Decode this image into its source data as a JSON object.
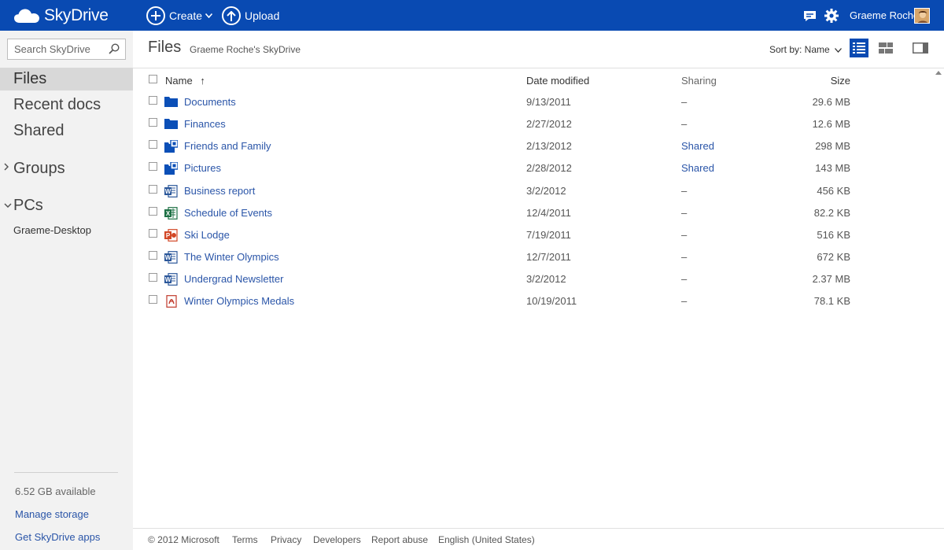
{
  "topbar": {
    "brand": "SkyDrive",
    "create_label": "Create",
    "upload_label": "Upload",
    "user_name": "Graeme Roche",
    "brand_color": "#094ab2"
  },
  "search": {
    "placeholder": "Search SkyDrive"
  },
  "nav": {
    "files": "Files",
    "recent": "Recent docs",
    "shared": "Shared",
    "groups": "Groups",
    "pcs": "PCs",
    "pc_name": "Graeme-Desktop",
    "storage": "6.52 GB available",
    "manage_storage": "Manage storage",
    "get_apps": "Get SkyDrive apps"
  },
  "header": {
    "title": "Files",
    "crumb": "Graeme Roche's SkyDrive",
    "sort_label": "Sort by: Name"
  },
  "columns": {
    "name": "Name",
    "sort_arrow": "↑",
    "date": "Date modified",
    "sharing": "Sharing",
    "size": "Size"
  },
  "files": [
    {
      "icon": "folder-icon",
      "name": "Documents",
      "date": "9/13/2011",
      "sharing": "–",
      "size": "29.6 MB"
    },
    {
      "icon": "folder-icon",
      "name": "Finances",
      "date": "2/27/2012",
      "sharing": "–",
      "size": "12.6 MB"
    },
    {
      "icon": "shared-folder-icon",
      "name": "Friends and Family",
      "date": "2/13/2012",
      "sharing": "Shared",
      "size": "298 MB"
    },
    {
      "icon": "shared-folder-icon",
      "name": "Pictures",
      "date": "2/28/2012",
      "sharing": "Shared",
      "size": "143 MB"
    },
    {
      "icon": "word-doc-icon",
      "name": "Business report",
      "date": "3/2/2012",
      "sharing": "–",
      "size": "456 KB"
    },
    {
      "icon": "excel-doc-icon",
      "name": "Schedule of Events",
      "date": "12/4/2011",
      "sharing": "–",
      "size": "82.2 KB"
    },
    {
      "icon": "powerpoint-doc-icon",
      "name": "Ski Lodge",
      "date": "7/19/2011",
      "sharing": "–",
      "size": "516 KB"
    },
    {
      "icon": "word-doc-icon",
      "name": "The Winter Olympics",
      "date": "12/7/2011",
      "sharing": "–",
      "size": "672 KB"
    },
    {
      "icon": "word-doc-icon",
      "name": "Undergrad Newsletter",
      "date": "3/2/2012",
      "sharing": "–",
      "size": "2.37 MB"
    },
    {
      "icon": "pdf-doc-icon",
      "name": "Winter Olympics Medals",
      "date": "10/19/2011",
      "sharing": "–",
      "size": "78.1 KB"
    }
  ],
  "footer": {
    "copyright": "© 2012 Microsoft",
    "terms": "Terms",
    "privacy": "Privacy",
    "developers": "Developers",
    "report_abuse": "Report abuse",
    "language": "English (United States)"
  }
}
